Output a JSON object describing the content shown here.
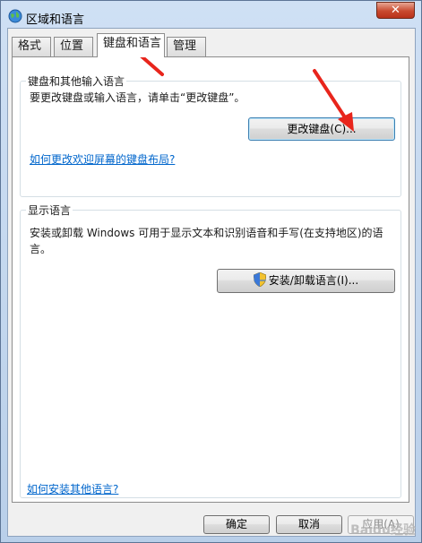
{
  "window": {
    "title": "区域和语言",
    "close_glyph": "✕"
  },
  "tabs": [
    {
      "label": "格式"
    },
    {
      "label": "位置"
    },
    {
      "label": "键盘和语言"
    },
    {
      "label": "管理"
    }
  ],
  "keyboard_group": {
    "title": "键盘和其他输入语言",
    "description": "要更改键盘或输入语言，请单击“更改键盘”。",
    "change_keyboard_button": "更改键盘(C)...",
    "welcome_screen_link": "如何更改欢迎屏幕的键盘布局?"
  },
  "display_group": {
    "title": "显示语言",
    "description_line1": "安装或卸载 Windows 可用于显示文本和识别语音和手写(在支持地区)的语",
    "description_line2": "言。",
    "install_button": "安装/卸载语言(I)..."
  },
  "install_more_link": "如何安装其他语言?",
  "footer": {
    "ok": "确定",
    "cancel": "取消",
    "apply": "应用(A)"
  },
  "watermark": "Baidu经验",
  "colors": {
    "annotation_arrow": "#e8251c",
    "link": "#0066cc"
  }
}
